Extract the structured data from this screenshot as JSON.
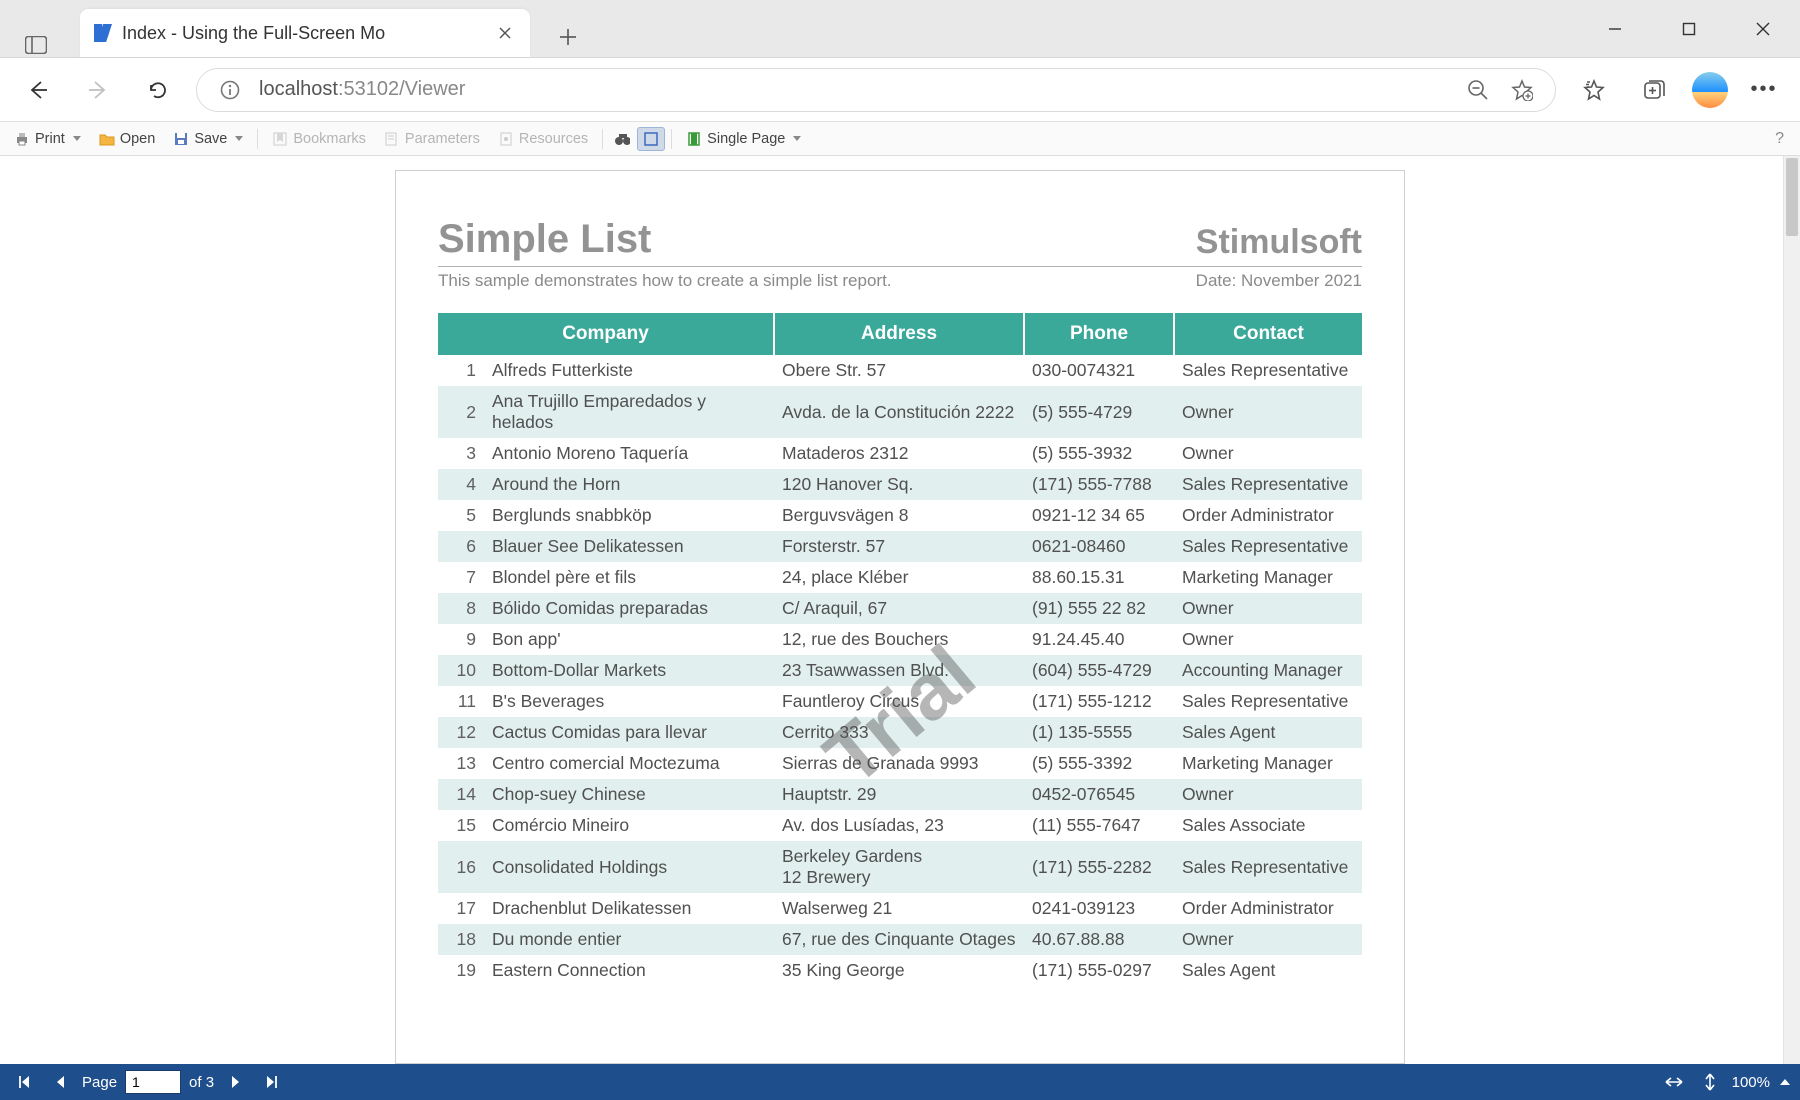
{
  "browser": {
    "tab_title": "Index - Using the Full-Screen Mo",
    "url_display_host": "localhost",
    "url_display_rest": ":53102/Viewer"
  },
  "toolbar": {
    "print": "Print",
    "open": "Open",
    "save": "Save",
    "bookmarks": "Bookmarks",
    "parameters": "Parameters",
    "resources": "Resources",
    "single_page": "Single Page",
    "help": "?"
  },
  "report": {
    "title": "Simple List",
    "brand": "Stimulsoft",
    "subtitle": "This sample demonstrates how to create a simple list report.",
    "date_label": "Date: November 2021",
    "watermark": "Trial",
    "columns": {
      "company": "Company",
      "address": "Address",
      "phone": "Phone",
      "contact": "Contact"
    },
    "rows": [
      {
        "n": "1",
        "company": "Alfreds Futterkiste",
        "address": "Obere Str. 57",
        "phone": "030-0074321",
        "contact": "Sales Representative"
      },
      {
        "n": "2",
        "company": "Ana Trujillo Emparedados y helados",
        "address": "Avda. de la Constitución 2222",
        "phone": "(5) 555-4729",
        "contact": "Owner"
      },
      {
        "n": "3",
        "company": "Antonio Moreno Taquería",
        "address": "Mataderos  2312",
        "phone": "(5) 555-3932",
        "contact": "Owner"
      },
      {
        "n": "4",
        "company": "Around the Horn",
        "address": "120 Hanover Sq.",
        "phone": "(171) 555-7788",
        "contact": "Sales Representative"
      },
      {
        "n": "5",
        "company": "Berglunds snabbköp",
        "address": "Berguvsvägen  8",
        "phone": "0921-12 34 65",
        "contact": "Order Administrator"
      },
      {
        "n": "6",
        "company": "Blauer See Delikatessen",
        "address": "Forsterstr. 57",
        "phone": "0621-08460",
        "contact": "Sales Representative"
      },
      {
        "n": "7",
        "company": "Blondel père et fils",
        "address": "24, place Kléber",
        "phone": "88.60.15.31",
        "contact": "Marketing Manager"
      },
      {
        "n": "8",
        "company": "Bólido Comidas preparadas",
        "address": "C/ Araquil, 67",
        "phone": "(91) 555 22 82",
        "contact": "Owner"
      },
      {
        "n": "9",
        "company": "Bon app'",
        "address": "12, rue des Bouchers",
        "phone": "91.24.45.40",
        "contact": "Owner"
      },
      {
        "n": "10",
        "company": "Bottom-Dollar Markets",
        "address": "23 Tsawwassen Blvd.",
        "phone": "(604) 555-4729",
        "contact": "Accounting Manager"
      },
      {
        "n": "11",
        "company": "B's Beverages",
        "address": "Fauntleroy Circus",
        "phone": "(171) 555-1212",
        "contact": "Sales Representative"
      },
      {
        "n": "12",
        "company": "Cactus Comidas para llevar",
        "address": "Cerrito 333",
        "phone": "(1) 135-5555",
        "contact": "Sales Agent"
      },
      {
        "n": "13",
        "company": "Centro comercial Moctezuma",
        "address": "Sierras de Granada 9993",
        "phone": "(5) 555-3392",
        "contact": "Marketing Manager"
      },
      {
        "n": "14",
        "company": "Chop-suey Chinese",
        "address": "Hauptstr. 29",
        "phone": "0452-076545",
        "contact": "Owner"
      },
      {
        "n": "15",
        "company": "Comércio Mineiro",
        "address": "Av. dos Lusíadas, 23",
        "phone": "(11) 555-7647",
        "contact": "Sales Associate"
      },
      {
        "n": "16",
        "company": "Consolidated Holdings",
        "address": "Berkeley Gardens\n12  Brewery",
        "phone": "(171) 555-2282",
        "contact": "Sales Representative"
      },
      {
        "n": "17",
        "company": "Drachenblut Delikatessen",
        "address": "Walserweg 21",
        "phone": "0241-039123",
        "contact": "Order Administrator"
      },
      {
        "n": "18",
        "company": "Du monde entier",
        "address": "67, rue des Cinquante Otages",
        "phone": "40.67.88.88",
        "contact": "Owner"
      },
      {
        "n": "19",
        "company": "Eastern Connection",
        "address": "35 King George",
        "phone": "(171) 555-0297",
        "contact": "Sales Agent"
      }
    ]
  },
  "status": {
    "page_label": "Page",
    "page_current": "1",
    "page_total": "of 3",
    "zoom": "100%"
  }
}
